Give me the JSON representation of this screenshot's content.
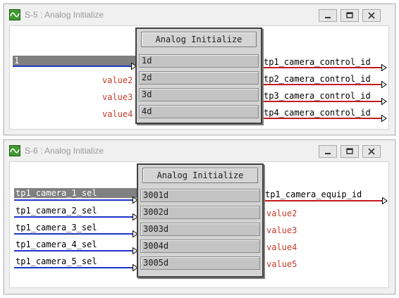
{
  "windows": [
    {
      "title": "S-5 : Analog Initialize",
      "block_title": "Analog Initialize",
      "cells": [
        "1d",
        "2d",
        "3d",
        "4d"
      ],
      "inputs": [
        {
          "label": "1",
          "connected": true,
          "selected": true
        },
        {
          "label": "value2",
          "connected": false
        },
        {
          "label": "value3",
          "connected": false
        },
        {
          "label": "value4",
          "connected": false
        }
      ],
      "outputs": [
        {
          "label": "tp1_camera_control_id",
          "connected": true
        },
        {
          "label": "tp2_camera_control_id",
          "connected": true
        },
        {
          "label": "tp3_camera_control_id",
          "connected": true
        },
        {
          "label": "tp4_camera_control_id",
          "connected": true
        }
      ]
    },
    {
      "title": "S-6 : Analog Initialize",
      "block_title": "Analog Initialize",
      "cells": [
        "3001d",
        "3002d",
        "3003d",
        "3004d",
        "3005d"
      ],
      "inputs": [
        {
          "label": "tp1_camera_1_sel",
          "connected": true,
          "selected": true
        },
        {
          "label": "tp1_camera_2_sel",
          "connected": true
        },
        {
          "label": "tp1_camera_3_sel",
          "connected": true
        },
        {
          "label": "tp1_camera_4_sel",
          "connected": true
        },
        {
          "label": "tp1_camera_5_sel",
          "connected": true
        }
      ],
      "outputs": [
        {
          "label": "tp1_camera_equip_id",
          "connected": true
        },
        {
          "label": "value2",
          "connected": false
        },
        {
          "label": "value3",
          "connected": false
        },
        {
          "label": "value4",
          "connected": false
        },
        {
          "label": "value5",
          "connected": false
        }
      ]
    }
  ],
  "titlebar_icons": [
    "app-signal-icon",
    "minimize-icon",
    "maximize-icon",
    "close-icon"
  ],
  "colors": {
    "input_wire": "#1d34c8",
    "output_wire": "#c41a1a",
    "unconnected_label": "#c43c2c",
    "block_face": "#d4d4d4"
  }
}
